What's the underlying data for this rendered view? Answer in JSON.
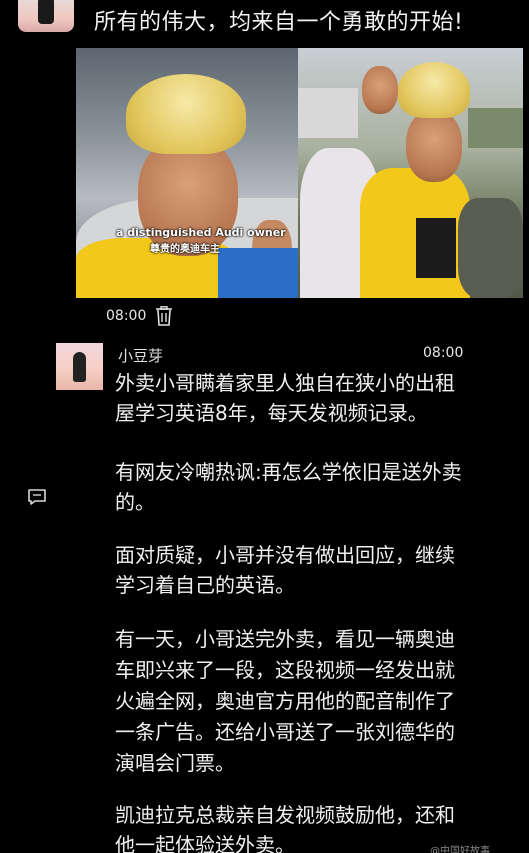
{
  "top_post": {
    "text": "所有的伟大，均来自一个勇敢的开始!"
  },
  "media": {
    "left_caption_en": "a distinguished Audi owner",
    "left_caption_zh": "尊贵的奥迪车主",
    "time": "08:00"
  },
  "post": {
    "username": "小豆芽",
    "time": "08:00",
    "lines": [
      "外卖小哥瞒着家里人独自在狭小的出租",
      "屋学习英语8年，每天发视频记录。",
      "有网友冷嘲热讽:再怎么学依旧是送外卖",
      "的。",
      "面对质疑，小哥并没有做出回应，继续",
      "学习着自己的英语。",
      "有一天，小哥送完外卖，看见一辆奥迪",
      "车即兴来了一段，这段视频一经发出就",
      "火遍全网，奥迪官方用他的配音制作了",
      "一条广告。还给小哥送了一张刘德华的",
      "演唱会门票。",
      "凯迪拉克总裁亲自发视频鼓励他，还和",
      "他一起体验送外卖。"
    ]
  },
  "watermark": "@中国好故事",
  "icons": {
    "delete": "trash-icon",
    "comment": "comment-icon"
  },
  "colors": {
    "background": "#000000",
    "text": "#f0f0f0"
  }
}
